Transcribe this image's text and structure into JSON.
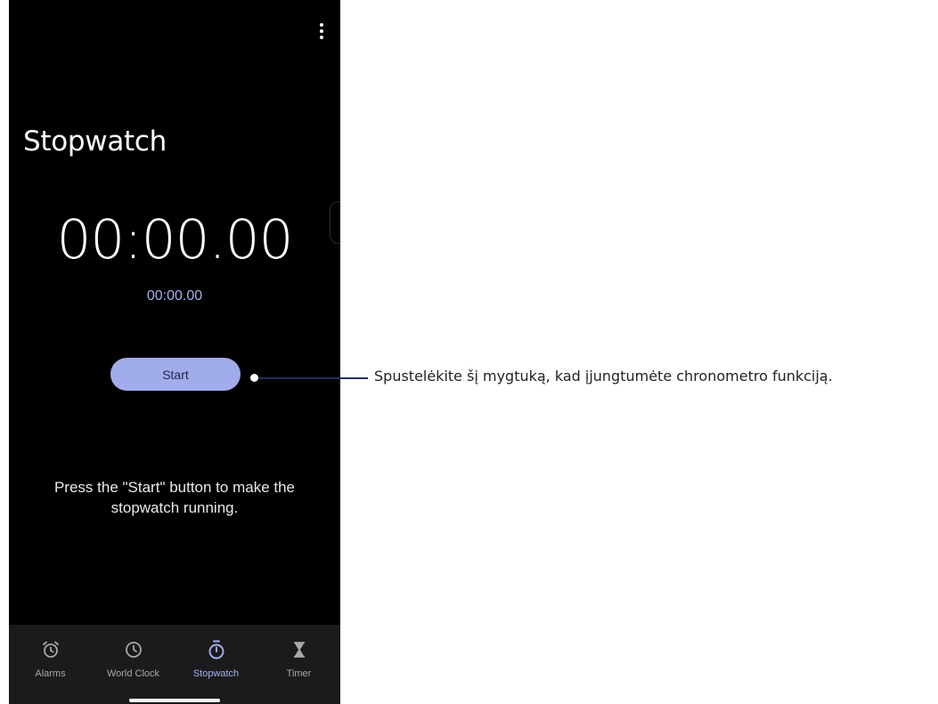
{
  "screen": {
    "title": "Stopwatch",
    "main_time": "00:00.00",
    "lap_time": "00:00.00",
    "start_label": "Start",
    "hint": "Press the \"Start\" button to make the stopwatch running.",
    "menu_icon": "more-vertical-icon"
  },
  "nav": {
    "items": [
      {
        "label": "Alarms",
        "icon": "alarm-clock-icon",
        "active": false
      },
      {
        "label": "World Clock",
        "icon": "clock-icon",
        "active": false
      },
      {
        "label": "Stopwatch",
        "icon": "stopwatch-icon",
        "active": true
      },
      {
        "label": "Timer",
        "icon": "hourglass-icon",
        "active": false
      }
    ]
  },
  "annotation": {
    "callout_text": "Spustelėkite šį mygtuką, kad įjungtumėte chronometro funkciją."
  },
  "colors": {
    "background": "#000000",
    "accent": "#a1acea",
    "accent_text": "#a6b0ec",
    "nav_background": "#1b1b1d"
  }
}
